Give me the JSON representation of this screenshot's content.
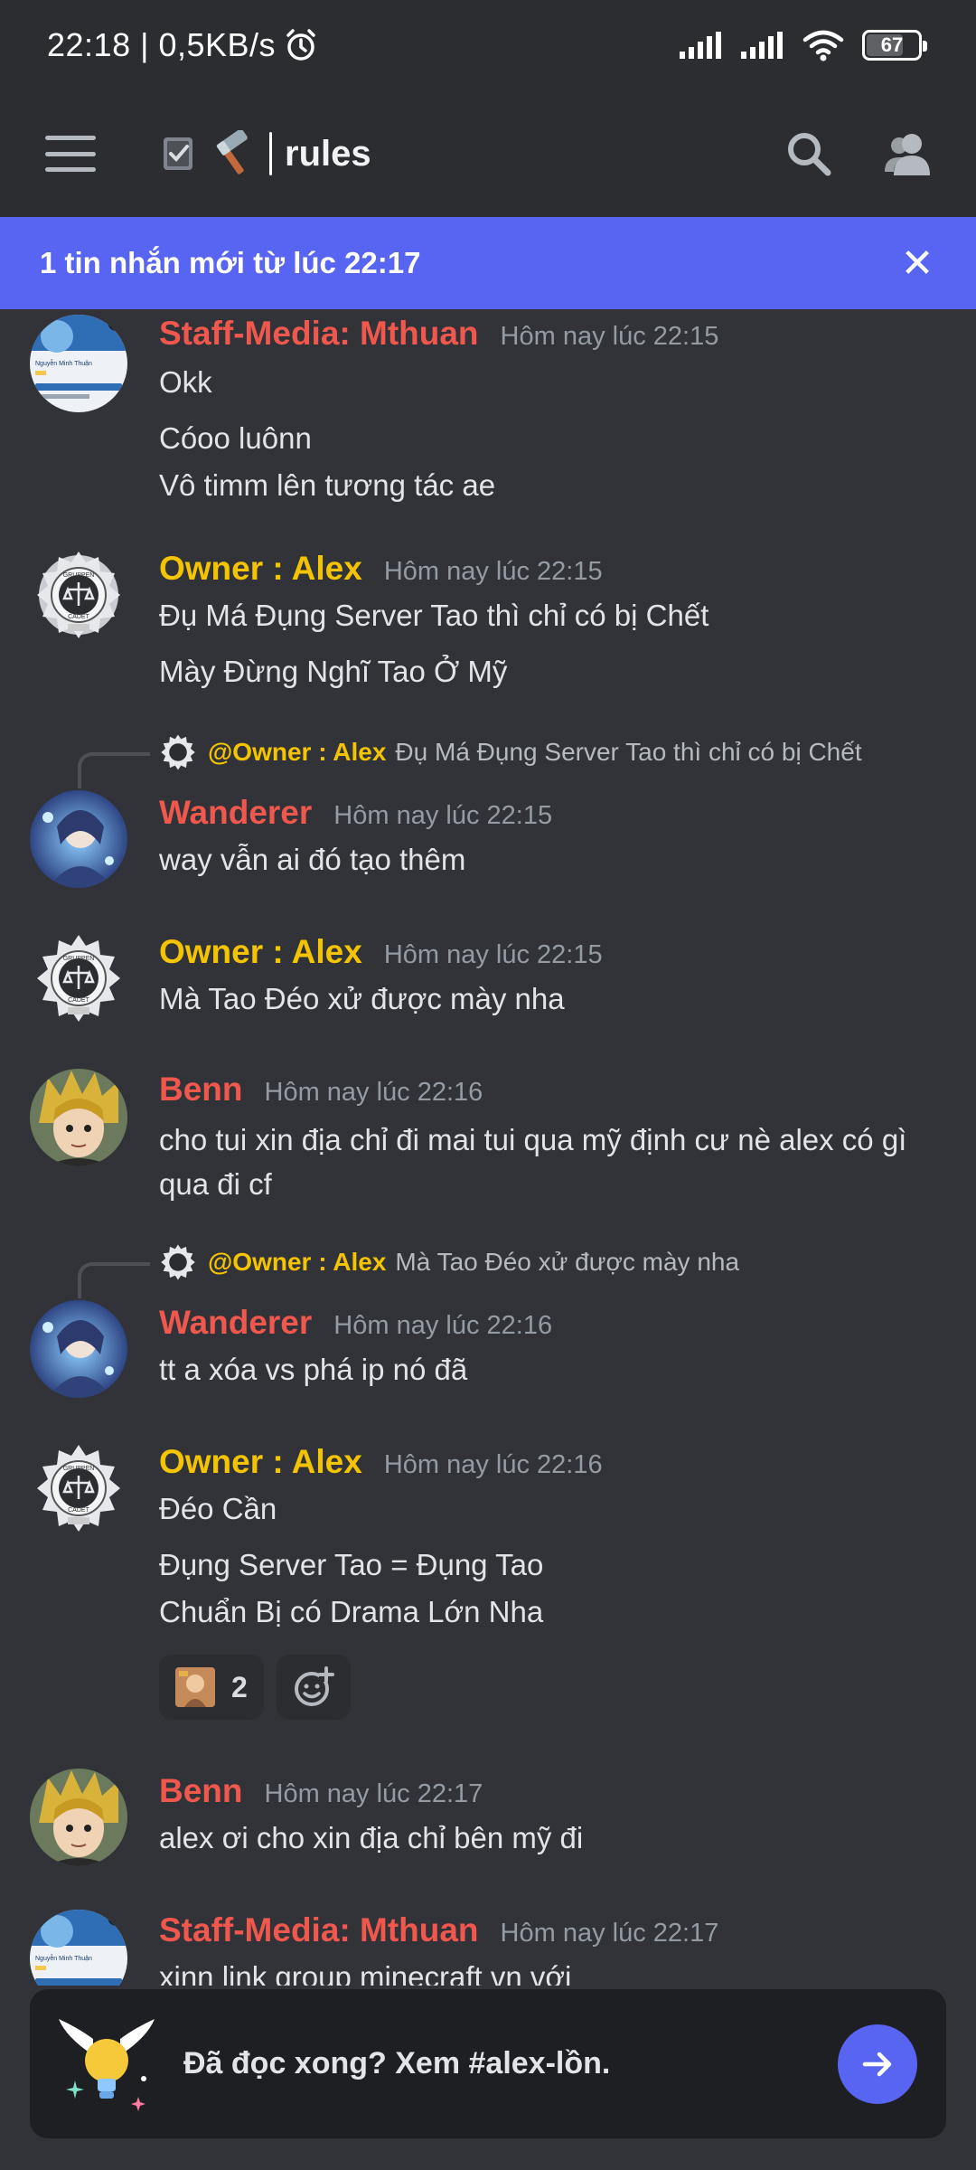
{
  "status_bar": {
    "time": "22:18 | 0,5KB/s",
    "battery": "67",
    "battery_level": 0.67
  },
  "header": {
    "channel_name": "rules",
    "channel_emoji_1": "☑",
    "channel_emoji_2": "🔨"
  },
  "banner": {
    "text": "1 tin nhắn mới từ lúc 22:17",
    "close_label": "✕"
  },
  "messages": [
    {
      "author": "Staff-Media: Mthuan",
      "timestamp": "Hôm nay lúc 22:15",
      "lines": [
        "Okk",
        "Cóoo luônn",
        "Vô timm lên tương tác ae"
      ]
    },
    {
      "author": "Owner : Alex",
      "timestamp": "Hôm nay lúc 22:15",
      "lines": [
        "Đụ Má Đụng Server Tao thì chỉ có bị Chết",
        "Mày Đừng Nghĩ Tao Ở Mỹ"
      ]
    },
    {
      "reply_to": {
        "author": "@Owner : Alex",
        "text": "Đụ Má Đụng Server Tao thì chỉ có bị Chết"
      },
      "author": "Wanderer",
      "timestamp": "Hôm nay lúc 22:15",
      "lines": [
        "way vẫn ai đó tạo thêm"
      ]
    },
    {
      "author": "Owner : Alex",
      "timestamp": "Hôm nay lúc 22:15",
      "lines": [
        "Mà Tao Đéo xử được mày nha"
      ]
    },
    {
      "author": "Benn",
      "timestamp": "Hôm nay lúc 22:16",
      "lines": [
        "cho tui xin địa chỉ đi mai tui qua mỹ định cư nè alex có gì qua đi cf"
      ]
    },
    {
      "reply_to": {
        "author": "@Owner : Alex",
        "text": "Mà Tao Đéo xử được mày nha"
      },
      "author": "Wanderer",
      "timestamp": "Hôm nay lúc 22:16",
      "lines": [
        "tt a xóa vs phá ip nó đã"
      ]
    },
    {
      "author": "Owner : Alex",
      "timestamp": "Hôm nay lúc 22:16",
      "lines": [
        "Đéo Cần",
        "Đụng Server Tao = Đụng Tao",
        "Chuẩn Bị có Drama Lớn Nha"
      ],
      "reaction_count": "2"
    },
    {
      "author": "Benn",
      "timestamp": "Hôm nay lúc 22:17",
      "lines": [
        "alex ơi cho xin địa chỉ bên mỹ đi"
      ]
    },
    {
      "author": "Staff-Media: Mthuan",
      "timestamp": "Hôm nay lúc 22:17",
      "lines": [
        "xinn link group minecraft vn với"
      ]
    }
  ],
  "footer": {
    "prompt": "Đã đọc xong? Xem #alex-lồn."
  },
  "colors": {
    "background": "#313338",
    "header": "#2b2d31",
    "accent": "#5865f2",
    "owner_name": "#f5c400",
    "red_name": "#f0574d"
  }
}
